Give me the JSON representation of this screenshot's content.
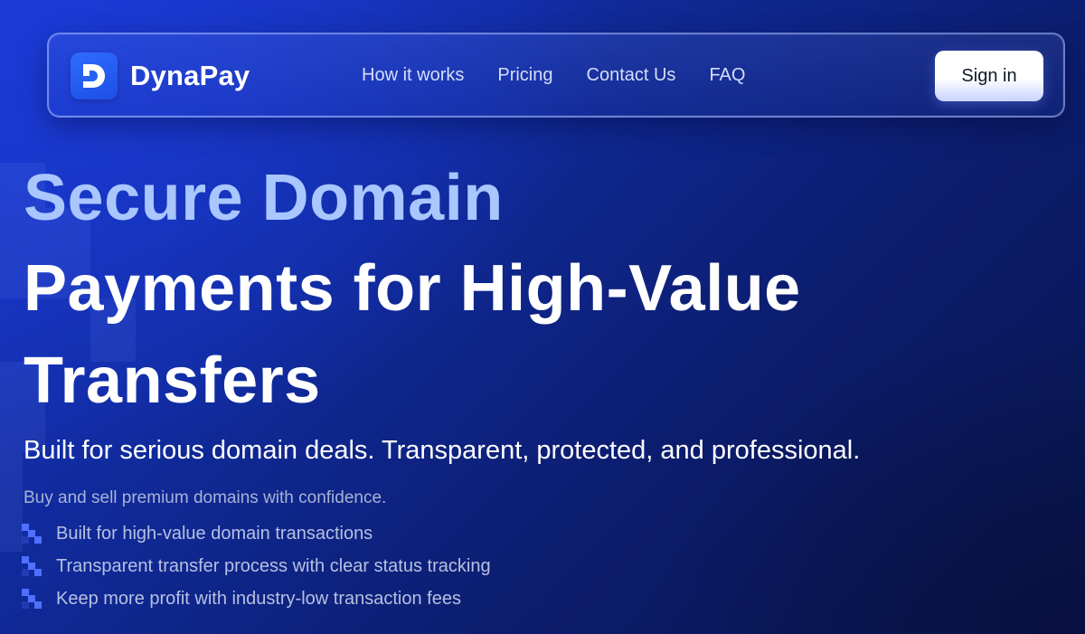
{
  "brand": {
    "name": "DynaPay",
    "logo_icon": "dp-logo-icon",
    "accent_color": "#2f6bff"
  },
  "nav": {
    "links": [
      {
        "label": "How it works"
      },
      {
        "label": "Pricing"
      },
      {
        "label": "Contact Us"
      },
      {
        "label": "FAQ"
      }
    ],
    "signin_label": "Sign in"
  },
  "hero": {
    "headline_1": "Secure Domain",
    "headline_2": "Payments for High-Value",
    "headline_3": "Transfers",
    "subtitle": "Built for serious domain deals. Transparent, protected, and professional.",
    "description": "Buy and sell premium domains with confidence.",
    "features": [
      {
        "text": "Built for high-value domain transactions",
        "icon": "checker-bullet-icon"
      },
      {
        "text": "Transparent transfer process with clear status tracking",
        "icon": "checker-bullet-icon"
      },
      {
        "text": "Keep more profit with industry-low transaction fees",
        "icon": "checker-bullet-icon"
      }
    ]
  },
  "colors": {
    "headline_accent": "#a9c6ff",
    "background_start": "#1836c9",
    "background_end": "#08164f",
    "bullet_color": "#4f6fff"
  }
}
